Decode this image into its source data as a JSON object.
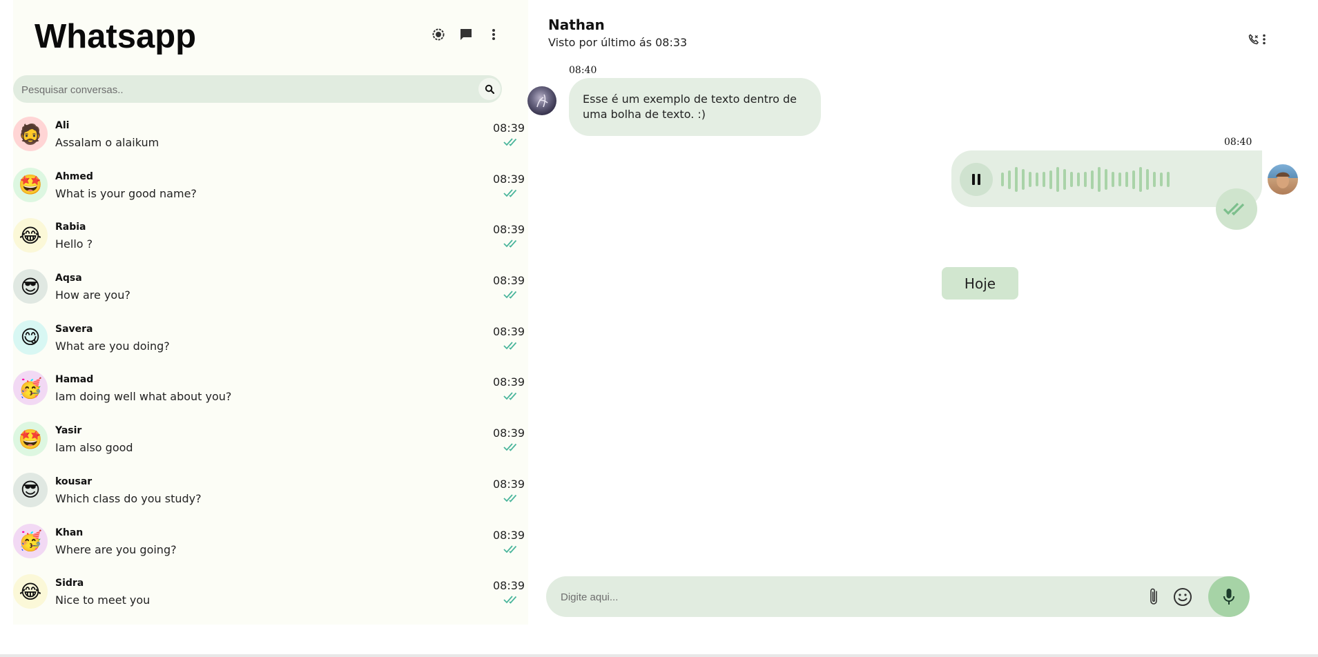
{
  "app": {
    "title": "Whatsapp"
  },
  "sidebar": {
    "header_icons": [
      "status-icon",
      "new-chat-icon",
      "more-options-icon"
    ],
    "search": {
      "placeholder": "Pesquisar conversas.."
    },
    "chats": [
      {
        "name": "Ali",
        "message": "Assalam o alaikum",
        "time": "08:39",
        "avatar_bg": "#ffd5d5",
        "emoji": "🧔"
      },
      {
        "name": "Ahmed",
        "message": "What is your good name?",
        "time": "08:39",
        "avatar_bg": "#ddf7e1",
        "emoji": "🤩"
      },
      {
        "name": "Rabia",
        "message": "Hello ?",
        "time": "08:39",
        "avatar_bg": "#fbf8d8",
        "emoji": "😂"
      },
      {
        "name": "Aqsa",
        "message": "How are you?",
        "time": "08:39",
        "avatar_bg": "#e0e8e2",
        "emoji": "😎"
      },
      {
        "name": "Savera",
        "message": "What are you doing?",
        "time": "08:39",
        "avatar_bg": "#d8f7f3",
        "emoji": "😋"
      },
      {
        "name": "Hamad",
        "message": "Iam doing well what about you?",
        "time": "08:39",
        "avatar_bg": "#f2d9f4",
        "emoji": "🥳"
      },
      {
        "name": "Yasir",
        "message": "Iam also good",
        "time": "08:39",
        "avatar_bg": "#ddf7e1",
        "emoji": "🤩"
      },
      {
        "name": "kousar",
        "message": "Which class do you study?",
        "time": "08:39",
        "avatar_bg": "#e0e8e2",
        "emoji": "😎"
      },
      {
        "name": "Khan",
        "message": "Where are you going?",
        "time": "08:39",
        "avatar_bg": "#f2d9f4",
        "emoji": "🥳"
      },
      {
        "name": "Sidra",
        "message": "Nice to meet you",
        "time": "08:39",
        "avatar_bg": "#fbf8d8",
        "emoji": "😂"
      }
    ]
  },
  "chat": {
    "contact_name": "Nathan",
    "last_seen": "Visto por último ás 08:33",
    "header_icons": [
      "call-icon",
      "more-options-icon"
    ],
    "messages": {
      "incoming": {
        "time": "08:40",
        "text": "Esse é um exemplo de texto dentro de uma bolha de texto. :)"
      },
      "outgoing_audio": {
        "time": "08:40",
        "state": "playing"
      }
    },
    "date_separator": "Hoje",
    "compose": {
      "placeholder": "Digite aqui..."
    }
  },
  "colors": {
    "sidebar_bg": "#fcfdf6",
    "bubble_green": "#e4eee3",
    "accent_green": "#a6d3a6",
    "tick_color": "#49b59b"
  }
}
